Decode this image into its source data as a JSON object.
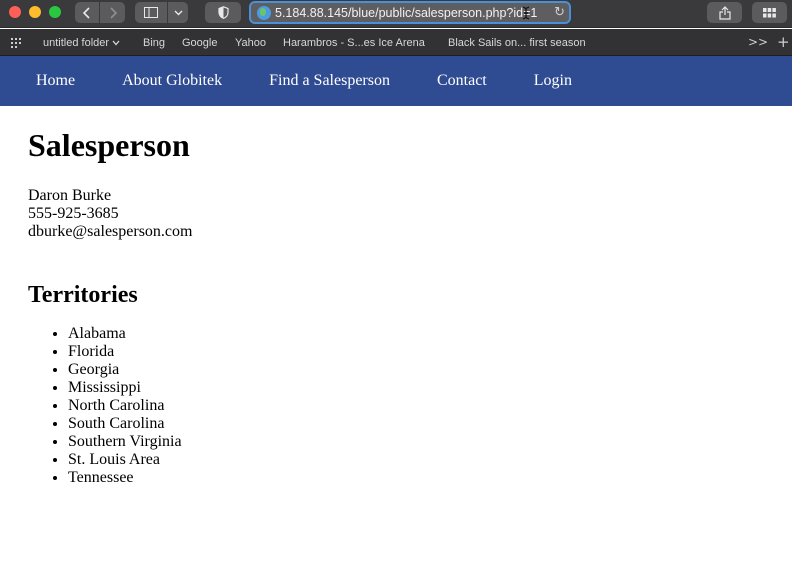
{
  "browser": {
    "url": "5.184.88.145/blue/public/salesperson.php?id=1",
    "bookmarks": [
      {
        "label": "untitled folder",
        "has_dropdown": true
      },
      {
        "label": "Bing"
      },
      {
        "label": "Google"
      },
      {
        "label": "Yahoo"
      },
      {
        "label": "Harambros - S...es Ice Arena"
      },
      {
        "label": "Black Sails on... first season"
      }
    ],
    "more_label": ">>",
    "add_label": "+"
  },
  "nav": {
    "color": "#2f4b91",
    "items": [
      "Home",
      "About Globitek",
      "Find a Salesperson",
      "Contact",
      "Login"
    ]
  },
  "page": {
    "title": "Salesperson",
    "name": "Daron Burke",
    "phone": "555-925-3685",
    "email": "dburke@salesperson.com",
    "territories_title": "Territories",
    "territories": [
      "Alabama",
      "Florida",
      "Georgia",
      "Mississippi",
      "North Carolina",
      "South Carolina",
      "Southern Virginia",
      "St. Louis Area",
      "Tennessee"
    ]
  }
}
